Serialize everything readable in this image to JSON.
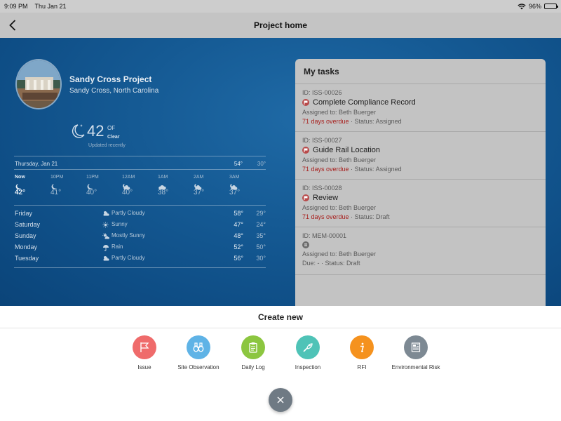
{
  "status_bar": {
    "time": "9:09 PM",
    "date": "Thu Jan 21",
    "battery": "96%",
    "battery_level": 0.96
  },
  "nav": {
    "title": "Project home"
  },
  "project": {
    "name": "Sandy Cross Project",
    "location": "Sandy Cross, North Carolina"
  },
  "weather": {
    "current_temp": "42",
    "unit": "OF",
    "condition": "Clear",
    "updated": "Updated recently",
    "today": {
      "label": "Thursday, Jan 21",
      "hi": "54°",
      "lo": "30°"
    },
    "hourly": [
      {
        "label": "Now",
        "temp": "42°",
        "icon": "moon-icon"
      },
      {
        "label": "10PM",
        "temp": "41°",
        "icon": "moon-icon"
      },
      {
        "label": "11PM",
        "temp": "40°",
        "icon": "moon-icon"
      },
      {
        "label": "12AM",
        "temp": "40°",
        "icon": "moon-cloud-icon"
      },
      {
        "label": "1AM",
        "temp": "38°",
        "icon": "cloud-icon"
      },
      {
        "label": "2AM",
        "temp": "37°",
        "icon": "moon-cloud-icon"
      },
      {
        "label": "3AM",
        "temp": "37°",
        "icon": "moon-cloud-icon"
      }
    ],
    "daily": [
      {
        "day": "Friday",
        "condition": "Partly Cloudy",
        "hi": "58°",
        "lo": "29°",
        "icon": "partly-cloudy-icon"
      },
      {
        "day": "Saturday",
        "condition": "Sunny",
        "hi": "47°",
        "lo": "24°",
        "icon": "sun-icon"
      },
      {
        "day": "Sunday",
        "condition": "Mostly Sunny",
        "hi": "48°",
        "lo": "35°",
        "icon": "mostly-sunny-icon"
      },
      {
        "day": "Monday",
        "condition": "Rain",
        "hi": "52°",
        "lo": "50°",
        "icon": "rain-icon"
      },
      {
        "day": "Tuesday",
        "condition": "Partly Cloudy",
        "hi": "56°",
        "lo": "30°",
        "icon": "partly-cloudy-icon"
      }
    ]
  },
  "tasks": {
    "title": "My tasks",
    "items": [
      {
        "id": "ID: ISS-00026",
        "title": "Complete Compliance Record",
        "assigned": "Assigned to: Beth Buerger",
        "overdue": "71 days overdue",
        "status": " · Status: Assigned"
      },
      {
        "id": "ID: ISS-00027",
        "title": "Guide Rail Location",
        "assigned": "Assigned to: Beth Buerger",
        "overdue": "71 days overdue",
        "status": " · Status: Assigned"
      },
      {
        "id": "ID: ISS-00028",
        "title": "Review",
        "assigned": "Assigned to: Beth Buerger",
        "overdue": "71 days overdue",
        "status": " · Status: Draft"
      },
      {
        "id": "ID: MEM-00001",
        "title": "",
        "assigned": "Assigned to: Beth Buerger",
        "overdue": "",
        "status": "Due: - · Status: Draft"
      }
    ]
  },
  "create_new": {
    "title": "Create new",
    "items": [
      {
        "label": "Issue",
        "color": "#ef6b6b",
        "icon": "flag-icon"
      },
      {
        "label": "Site Observation",
        "color": "#5fb3e6",
        "icon": "binoculars-icon"
      },
      {
        "label": "Daily Log",
        "color": "#8cc640",
        "icon": "clipboard-icon"
      },
      {
        "label": "Inspection",
        "color": "#4fc3b7",
        "icon": "inspection-icon"
      },
      {
        "label": "RFI",
        "color": "#f5921e",
        "icon": "info-icon"
      },
      {
        "label": "Environmental Risk",
        "color": "#7d8993",
        "icon": "document-icon"
      }
    ]
  }
}
